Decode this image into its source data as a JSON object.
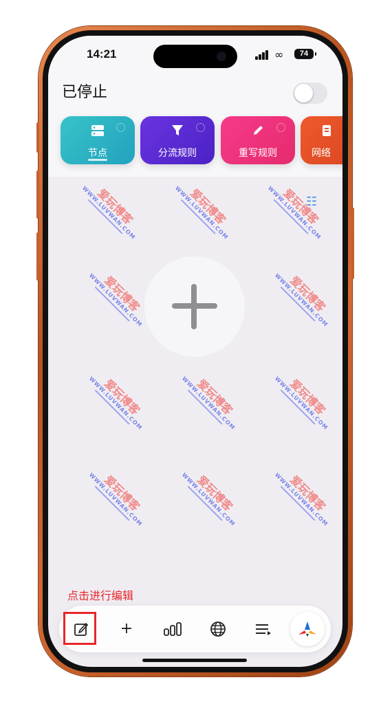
{
  "status_bar": {
    "time": "14:21",
    "battery": "74"
  },
  "header": {
    "status": "已停止"
  },
  "cards": [
    {
      "label": "节点",
      "icon": "server-icon",
      "color": "#2eb6c0"
    },
    {
      "label": "分流规则",
      "icon": "filter-icon",
      "color": "#5b2ed6"
    },
    {
      "label": "重写规则",
      "icon": "pencil-icon",
      "color": "#f0307a"
    },
    {
      "label": "网络",
      "icon": "document-icon",
      "color": "#e6502a"
    }
  ],
  "watermark": {
    "cn": "爱玩博客",
    "en": "WWW.LUVWAN.COM"
  },
  "hint": "点击进行编辑",
  "tabbar": {
    "items": [
      "edit-icon",
      "plus-icon",
      "stats-icon",
      "globe-icon",
      "list-icon",
      "app-logo-icon"
    ]
  },
  "colors": {
    "accent_red": "#e8262a",
    "frame": "#c2622c"
  }
}
